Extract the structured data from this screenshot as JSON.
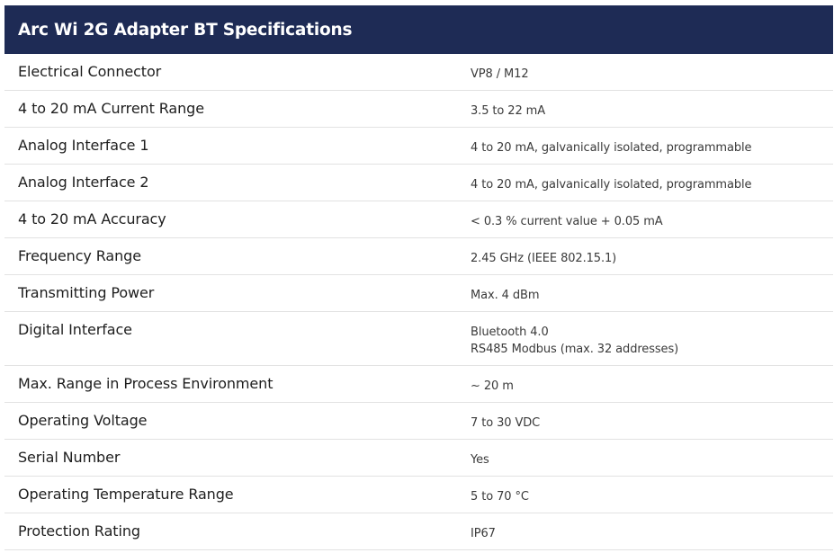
{
  "title": "Arc Wi 2G Adapter BT Specifications",
  "rows": [
    {
      "label": "Electrical Connector",
      "value": [
        "VP8 / M12"
      ]
    },
    {
      "label": "4 to 20 mA Current Range",
      "value": [
        "3.5 to 22 mA"
      ]
    },
    {
      "label": "Analog Interface 1",
      "value": [
        "4 to 20 mA, galvanically isolated, programmable"
      ]
    },
    {
      "label": "Analog Interface 2",
      "value": [
        "4 to 20 mA, galvanically isolated, programmable"
      ]
    },
    {
      "label": "4 to 20 mA Accuracy",
      "value": [
        "< 0.3 % current value + 0.05 mA"
      ]
    },
    {
      "label": "Frequency Range",
      "value": [
        "2.45 GHz (IEEE 802.15.1)"
      ]
    },
    {
      "label": "Transmitting Power",
      "value": [
        "Max. 4 dBm"
      ]
    },
    {
      "label": "Digital Interface",
      "value": [
        "Bluetooth 4.0",
        "RS485 Modbus (max. 32 addresses)"
      ]
    },
    {
      "label": "Max. Range in Process Environment",
      "value": [
        "~ 20 m"
      ]
    },
    {
      "label": "Operating Voltage",
      "value": [
        "7 to 30 VDC"
      ]
    },
    {
      "label": "Serial Number",
      "value": [
        "Yes"
      ]
    },
    {
      "label": "Operating Temperature Range",
      "value": [
        "5 to 70 °C"
      ]
    },
    {
      "label": "Protection Rating",
      "value": [
        "IP67"
      ]
    }
  ]
}
